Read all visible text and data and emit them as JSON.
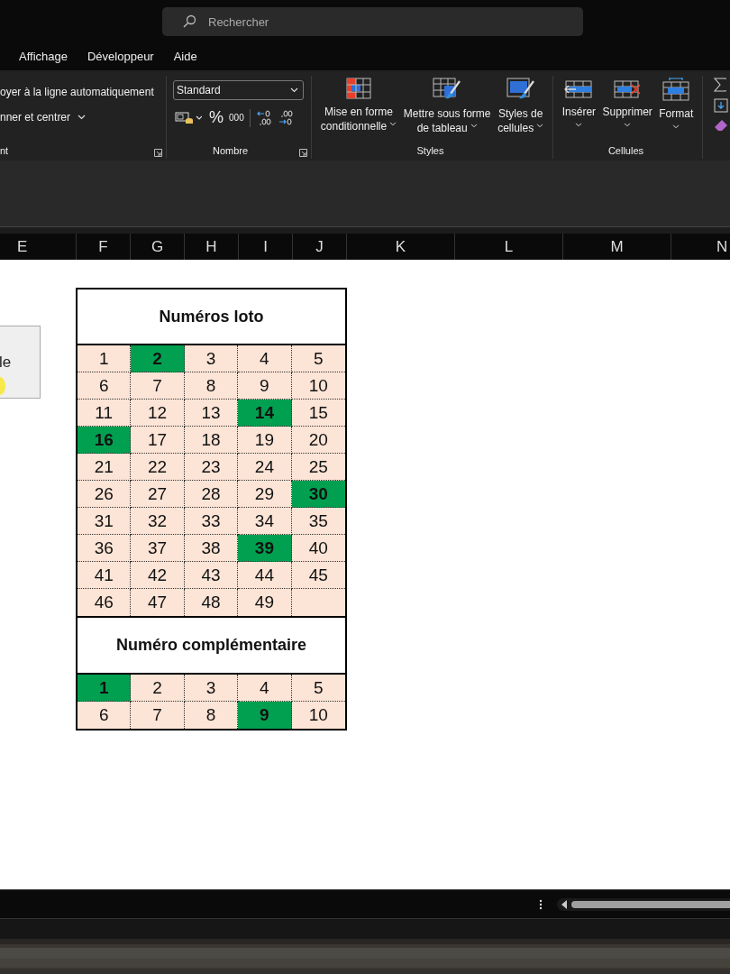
{
  "search": {
    "placeholder": "Rechercher"
  },
  "menu": [
    "Affichage",
    "Développeur",
    "Aide"
  ],
  "ribbon": {
    "alignment": {
      "wrap": "oyer à la ligne automatiquement",
      "merge": "nner et centrer",
      "label": "nt"
    },
    "number": {
      "format": "Standard",
      "percent": "%",
      "thousands": "000",
      "label": "Nombre"
    },
    "styles": {
      "buttons": [
        {
          "line1": "Mise en forme",
          "line2": "conditionnelle"
        },
        {
          "line1": "Mettre sous forme",
          "line2": "de tableau"
        },
        {
          "line1": "Styles de",
          "line2": "cellules"
        }
      ],
      "label": "Styles"
    },
    "cells": {
      "buttons": [
        "Insérer",
        "Supprimer",
        "Format"
      ],
      "label": "Cellules"
    }
  },
  "columns": [
    "E",
    "F",
    "G",
    "H",
    "I",
    "J",
    "K",
    "L",
    "M",
    "N"
  ],
  "sheet_button": {
    "label": "le"
  },
  "loto": {
    "title": "Numéros loto",
    "numbers": [
      {
        "label": "1",
        "selected": false
      },
      {
        "label": "2",
        "selected": true
      },
      {
        "label": "3",
        "selected": false
      },
      {
        "label": "4",
        "selected": false
      },
      {
        "label": "5",
        "selected": false
      },
      {
        "label": "6",
        "selected": false
      },
      {
        "label": "7",
        "selected": false
      },
      {
        "label": "8",
        "selected": false
      },
      {
        "label": "9",
        "selected": false
      },
      {
        "label": "10",
        "selected": false
      },
      {
        "label": "11",
        "selected": false
      },
      {
        "label": "12",
        "selected": false
      },
      {
        "label": "13",
        "selected": false
      },
      {
        "label": "14",
        "selected": true
      },
      {
        "label": "15",
        "selected": false
      },
      {
        "label": "16",
        "selected": true
      },
      {
        "label": "17",
        "selected": false
      },
      {
        "label": "18",
        "selected": false
      },
      {
        "label": "19",
        "selected": false
      },
      {
        "label": "20",
        "selected": false
      },
      {
        "label": "21",
        "selected": false
      },
      {
        "label": "22",
        "selected": false
      },
      {
        "label": "23",
        "selected": false
      },
      {
        "label": "24",
        "selected": false
      },
      {
        "label": "25",
        "selected": false
      },
      {
        "label": "26",
        "selected": false
      },
      {
        "label": "27",
        "selected": false
      },
      {
        "label": "28",
        "selected": false
      },
      {
        "label": "29",
        "selected": false
      },
      {
        "label": "30",
        "selected": true
      },
      {
        "label": "31",
        "selected": false
      },
      {
        "label": "32",
        "selected": false
      },
      {
        "label": "33",
        "selected": false
      },
      {
        "label": "34",
        "selected": false
      },
      {
        "label": "35",
        "selected": false
      },
      {
        "label": "36",
        "selected": false
      },
      {
        "label": "37",
        "selected": false
      },
      {
        "label": "38",
        "selected": false
      },
      {
        "label": "39",
        "selected": true
      },
      {
        "label": "40",
        "selected": false
      },
      {
        "label": "41",
        "selected": false
      },
      {
        "label": "42",
        "selected": false
      },
      {
        "label": "43",
        "selected": false
      },
      {
        "label": "44",
        "selected": false
      },
      {
        "label": "45",
        "selected": false
      },
      {
        "label": "46",
        "selected": false
      },
      {
        "label": "47",
        "selected": false
      },
      {
        "label": "48",
        "selected": false
      },
      {
        "label": "49",
        "selected": false
      }
    ]
  },
  "complementary": {
    "title": "Numéro complémentaire",
    "numbers": [
      {
        "label": "1",
        "selected": true
      },
      {
        "label": "2",
        "selected": false
      },
      {
        "label": "3",
        "selected": false
      },
      {
        "label": "4",
        "selected": false
      },
      {
        "label": "5",
        "selected": false
      },
      {
        "label": "6",
        "selected": false
      },
      {
        "label": "7",
        "selected": false
      },
      {
        "label": "8",
        "selected": false
      },
      {
        "label": "9",
        "selected": true
      },
      {
        "label": "10",
        "selected": false
      }
    ]
  }
}
